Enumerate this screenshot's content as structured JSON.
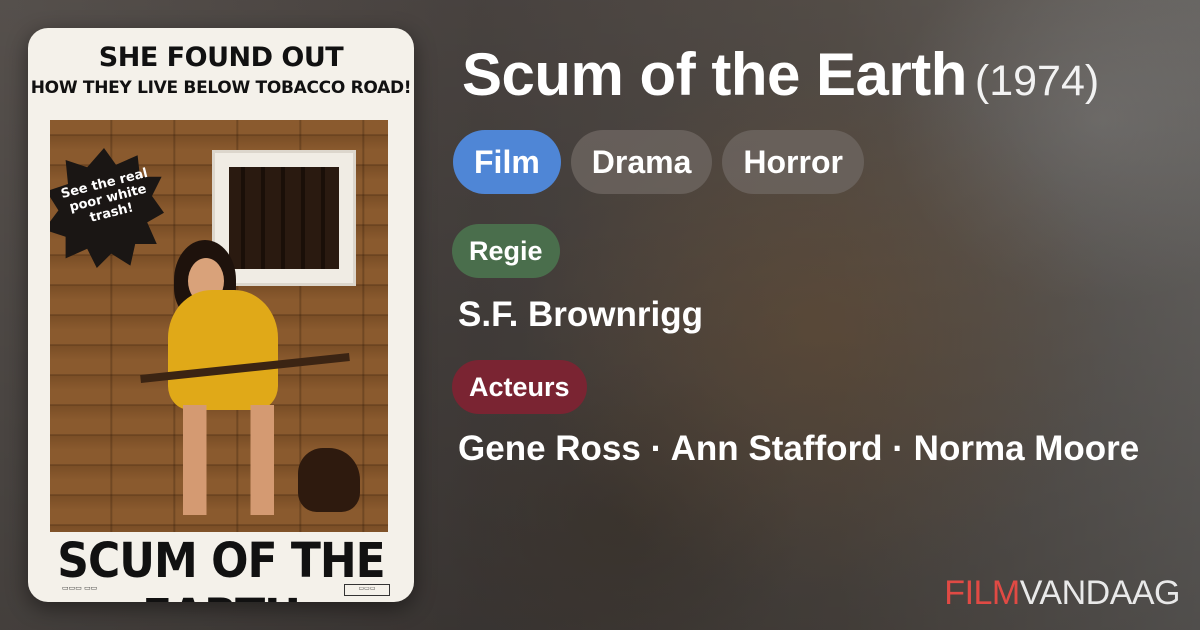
{
  "poster": {
    "tagline": "SHE FOUND OUT",
    "subtagline": "HOW THEY LIVE BELOW TOBACCO ROAD!",
    "burst_text": "See the real poor white trash!",
    "title_art": "SCUM OF THE EARTH"
  },
  "movie": {
    "title": "Scum of the Earth",
    "year": "(1974)"
  },
  "genres": [
    {
      "label": "Film",
      "active": true
    },
    {
      "label": "Drama",
      "active": false
    },
    {
      "label": "Horror",
      "active": false
    }
  ],
  "credits": {
    "director_label": "Regie",
    "director": "S.F. Brownrigg",
    "actors_label": "Acteurs",
    "actors": "Gene Ross · Ann Stafford · Norma Moore"
  },
  "brand": {
    "part1": "FILM",
    "part2": "VANDAAG"
  },
  "colors": {
    "film_pill": "#4f86d6",
    "regie_badge": "#4a6e4c",
    "acteurs_badge": "#7a2432",
    "brand_red": "#e04a44"
  }
}
